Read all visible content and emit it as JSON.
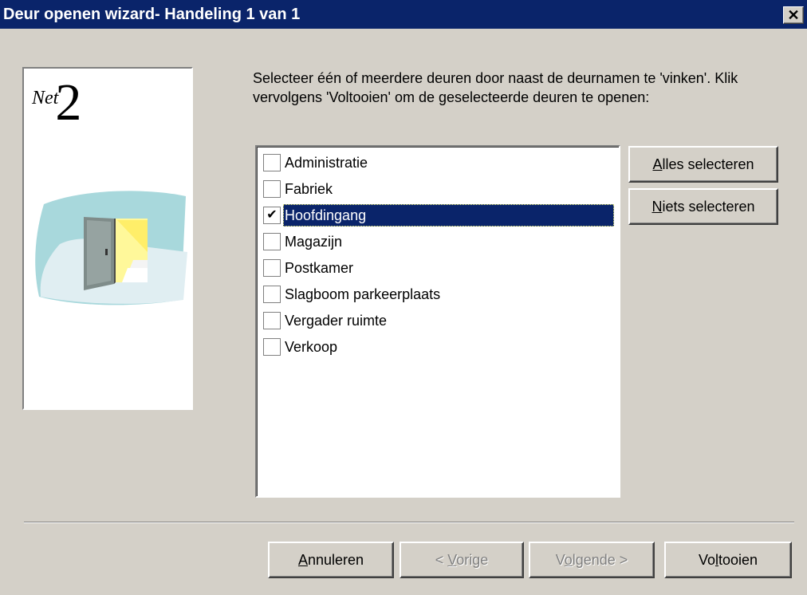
{
  "window": {
    "title": "Deur openen wizard- Handeling 1 van 1",
    "close_symbol": "✕"
  },
  "sidebar_image": {
    "logo_prefix": "Net",
    "logo_number": "2",
    "illustration": "open-door-icon"
  },
  "instructions": "Selecteer één of meerdere deuren door naast de deurnamen te 'vinken'. Klik vervolgens 'Voltooien' om de geselecteerde deuren te openen:",
  "doors": [
    {
      "label": "Administratie",
      "checked": false,
      "selected": false
    },
    {
      "label": "Fabriek",
      "checked": false,
      "selected": false
    },
    {
      "label": "Hoofdingang",
      "checked": true,
      "selected": true
    },
    {
      "label": "Magazijn",
      "checked": false,
      "selected": false
    },
    {
      "label": "Postkamer",
      "checked": false,
      "selected": false
    },
    {
      "label": "Slagboom parkeerplaats",
      "checked": false,
      "selected": false
    },
    {
      "label": "Vergader ruimte",
      "checked": false,
      "selected": false
    },
    {
      "label": "Verkoop",
      "checked": false,
      "selected": false
    }
  ],
  "checkmark": "✔",
  "side_buttons": {
    "select_all": {
      "label": "Alles selecteren",
      "accesskey": "A"
    },
    "select_none": {
      "label": "Niets selecteren",
      "accesskey": "N"
    }
  },
  "footer_buttons": {
    "cancel": {
      "label": "Annuleren",
      "accesskey": "A",
      "enabled": true
    },
    "previous": {
      "label": "< Vorige",
      "accesskey": "V",
      "enabled": false
    },
    "next": {
      "label": "Volgende >",
      "accesskey": "o",
      "enabled": false
    },
    "finish": {
      "label": "Voltooien",
      "accesskey": "l",
      "enabled": true
    }
  }
}
